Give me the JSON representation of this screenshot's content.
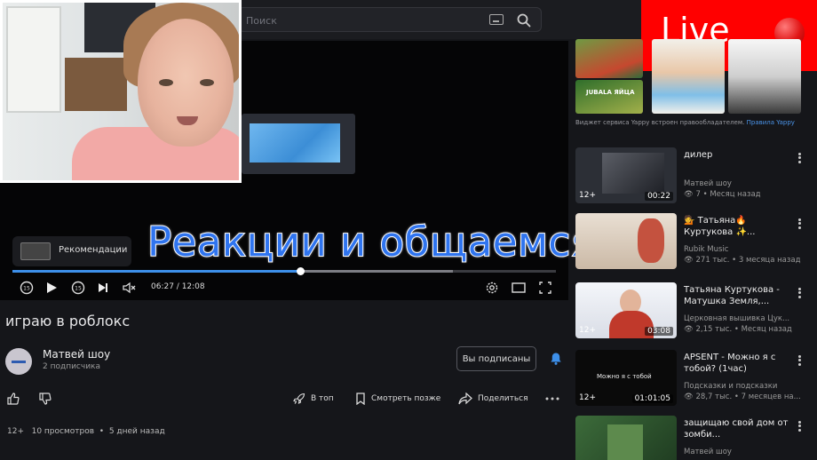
{
  "search": {
    "placeholder": "Поиск"
  },
  "player": {
    "inner_caption": "",
    "recommendations_label": "Рекомендации",
    "time": "06:27 / 12:08",
    "progress_fraction": 0.53,
    "buffer_fraction": 0.81
  },
  "overlay": {
    "caption": "Реакции и общаемся"
  },
  "live": {
    "label": "Live"
  },
  "video": {
    "title": "играю в роблокс",
    "channel": "Матвей шоу",
    "subscribers": "2 подписчика",
    "subscribe_button": "Вы подписаны",
    "actions": {
      "to_top": "В топ",
      "watch_later": "Смотреть позже",
      "share": "Поделиться"
    },
    "age": "12+",
    "views": "10 просмотров",
    "dot": "•",
    "date": "5 дней назад"
  },
  "sidebar": {
    "ad_text": "Виджет сервиса Yappy встроен правообладателем.",
    "ad_link": "Правила Yappy",
    "ad_card_label": "JUBALA ЯЙЦА",
    "items": [
      {
        "title": "дилер",
        "channel": "Матвей шоу",
        "views": "7",
        "date": "Месяц назад",
        "age": "12+",
        "duration": "00:22",
        "thumb_color": "#2c2f36"
      },
      {
        "title": "💁 Татьяна🔥 Куртукова ✨...",
        "channel": "Rubik Music",
        "views": "271 тыс.",
        "date": "3 месяца назад",
        "age": "",
        "duration": "",
        "thumb_color": "#d9cfc4"
      },
      {
        "title": "Татьяна Куртукова - Матушка Земля,...",
        "channel": "Церковная вышивка Цук...",
        "views": "2,15 тыс.",
        "date": "Месяц назад",
        "age": "12+",
        "duration": "03:08",
        "thumb_color": "#e4e8f0"
      },
      {
        "title": "APSENT - Можно я с тобой? (1час)",
        "channel": "Подсказки и подсказки",
        "views": "28,7 тыс.",
        "date": "7 месяцев на...",
        "age": "12+",
        "duration": "01:01:05",
        "thumb_color": "#0a0a0a",
        "thumb_text": "Можно я с тобой"
      },
      {
        "title": "защищаю свой дом от зомби...",
        "channel": "Матвей шоу",
        "views": "",
        "date": "",
        "age": "",
        "duration": "",
        "thumb_color": "#2a4a2a"
      }
    ]
  },
  "colors": {
    "accent": "#3d8fe9",
    "live": "#ff0000",
    "background": "#15161a"
  }
}
